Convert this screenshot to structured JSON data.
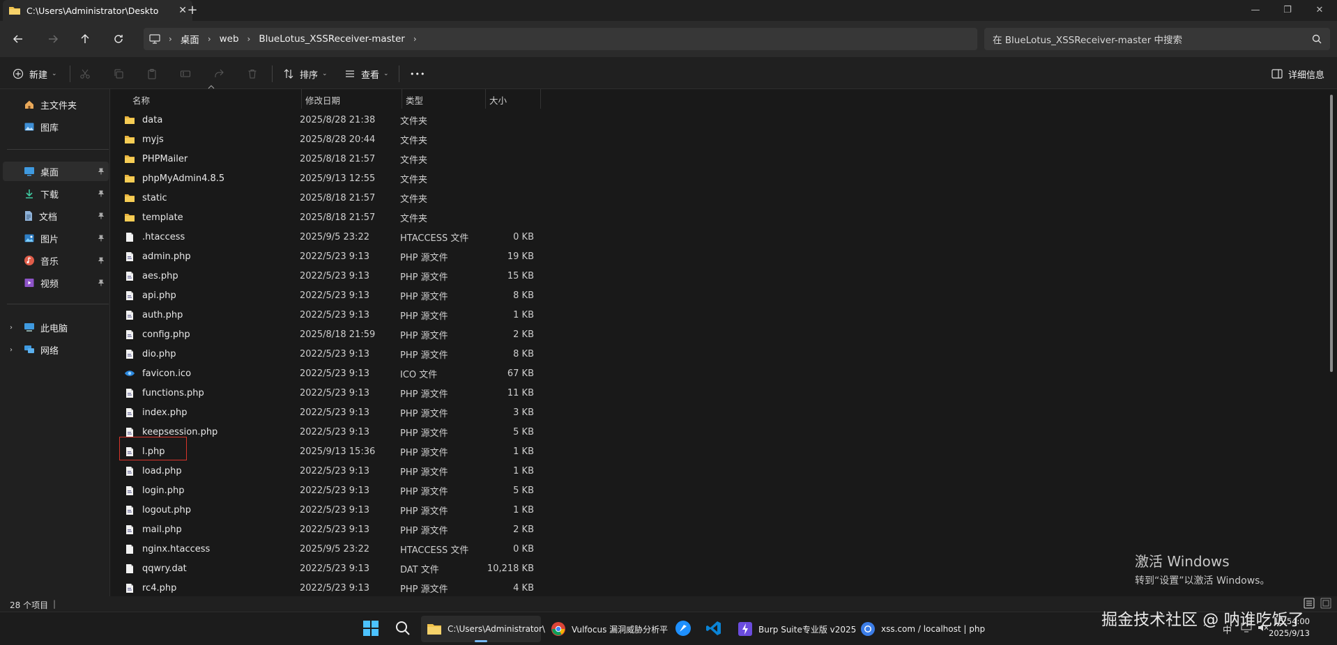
{
  "window": {
    "tab_title": "C:\\Users\\Administrator\\Deskto",
    "tab_close": "✕",
    "new_tab": "+",
    "min": "—",
    "max": "❐",
    "close": "✕"
  },
  "address": {
    "crumbs": [
      "桌面",
      "web",
      "BlueLotus_XSSReceiver-master"
    ],
    "search_placeholder": "在 BlueLotus_XSSReceiver-master 中搜索"
  },
  "toolbar": {
    "new": "新建",
    "sort": "排序",
    "view": "查看",
    "more": "•••",
    "details": "详细信息"
  },
  "sidebar": {
    "quick": [
      {
        "label": "主文件夹",
        "icon": "home-icon"
      },
      {
        "label": "图库",
        "icon": "gallery-icon"
      }
    ],
    "pinned": [
      {
        "label": "桌面",
        "icon": "desktop-icon"
      },
      {
        "label": "下载",
        "icon": "download-icon"
      },
      {
        "label": "文档",
        "icon": "document-icon"
      },
      {
        "label": "图片",
        "icon": "picture-icon"
      },
      {
        "label": "音乐",
        "icon": "music-icon"
      },
      {
        "label": "视频",
        "icon": "video-icon"
      }
    ],
    "devices": [
      {
        "label": "此电脑",
        "icon": "computer-icon"
      },
      {
        "label": "网络",
        "icon": "network-icon"
      }
    ],
    "pin_glyph": "📌",
    "expand_glyph": "›"
  },
  "columns": {
    "name": "名称",
    "date": "修改日期",
    "type": "类型",
    "size": "大小"
  },
  "files": [
    {
      "name": "data",
      "date": "2025/8/28 21:38",
      "type": "文件夹",
      "size": "",
      "kind": "folder"
    },
    {
      "name": "myjs",
      "date": "2025/8/28 20:44",
      "type": "文件夹",
      "size": "",
      "kind": "folder"
    },
    {
      "name": "PHPMailer",
      "date": "2025/8/18 21:57",
      "type": "文件夹",
      "size": "",
      "kind": "folder"
    },
    {
      "name": "phpMyAdmin4.8.5",
      "date": "2025/9/13 12:55",
      "type": "文件夹",
      "size": "",
      "kind": "folder"
    },
    {
      "name": "static",
      "date": "2025/8/18 21:57",
      "type": "文件夹",
      "size": "",
      "kind": "folder"
    },
    {
      "name": "template",
      "date": "2025/8/18 21:57",
      "type": "文件夹",
      "size": "",
      "kind": "folder"
    },
    {
      "name": ".htaccess",
      "date": "2025/9/5 23:22",
      "type": "HTACCESS 文件",
      "size": "0 KB",
      "kind": "file"
    },
    {
      "name": "admin.php",
      "date": "2022/5/23 9:13",
      "type": "PHP 源文件",
      "size": "19 KB",
      "kind": "php"
    },
    {
      "name": "aes.php",
      "date": "2022/5/23 9:13",
      "type": "PHP 源文件",
      "size": "15 KB",
      "kind": "php"
    },
    {
      "name": "api.php",
      "date": "2022/5/23 9:13",
      "type": "PHP 源文件",
      "size": "8 KB",
      "kind": "php"
    },
    {
      "name": "auth.php",
      "date": "2022/5/23 9:13",
      "type": "PHP 源文件",
      "size": "1 KB",
      "kind": "php"
    },
    {
      "name": "config.php",
      "date": "2025/8/18 21:59",
      "type": "PHP 源文件",
      "size": "2 KB",
      "kind": "php"
    },
    {
      "name": "dio.php",
      "date": "2022/5/23 9:13",
      "type": "PHP 源文件",
      "size": "8 KB",
      "kind": "php"
    },
    {
      "name": "favicon.ico",
      "date": "2022/5/23 9:13",
      "type": "ICO 文件",
      "size": "67 KB",
      "kind": "ico"
    },
    {
      "name": "functions.php",
      "date": "2022/5/23 9:13",
      "type": "PHP 源文件",
      "size": "11 KB",
      "kind": "php"
    },
    {
      "name": "index.php",
      "date": "2022/5/23 9:13",
      "type": "PHP 源文件",
      "size": "3 KB",
      "kind": "php"
    },
    {
      "name": "keepsession.php",
      "date": "2022/5/23 9:13",
      "type": "PHP 源文件",
      "size": "5 KB",
      "kind": "php"
    },
    {
      "name": "l.php",
      "date": "2025/9/13 15:36",
      "type": "PHP 源文件",
      "size": "1 KB",
      "kind": "php"
    },
    {
      "name": "load.php",
      "date": "2022/5/23 9:13",
      "type": "PHP 源文件",
      "size": "1 KB",
      "kind": "php"
    },
    {
      "name": "login.php",
      "date": "2022/5/23 9:13",
      "type": "PHP 源文件",
      "size": "5 KB",
      "kind": "php"
    },
    {
      "name": "logout.php",
      "date": "2022/5/23 9:13",
      "type": "PHP 源文件",
      "size": "1 KB",
      "kind": "php"
    },
    {
      "name": "mail.php",
      "date": "2022/5/23 9:13",
      "type": "PHP 源文件",
      "size": "2 KB",
      "kind": "php"
    },
    {
      "name": "nginx.htaccess",
      "date": "2025/9/5 23:22",
      "type": "HTACCESS 文件",
      "size": "0 KB",
      "kind": "file"
    },
    {
      "name": "qqwry.dat",
      "date": "2022/5/23 9:13",
      "type": "DAT 文件",
      "size": "10,218 KB",
      "kind": "file"
    },
    {
      "name": "rc4.php",
      "date": "2022/5/23 9:13",
      "type": "PHP 源文件",
      "size": "4 KB",
      "kind": "php"
    }
  ],
  "status": {
    "count": "28 个项目",
    "sep": "|"
  },
  "watermark": {
    "activate_title": "激活 Windows",
    "activate_sub": "转到“设置”以激活 Windows。",
    "community": "掘金技术社区 @ 呐谁吃饭了"
  },
  "taskbar": {
    "explorer": "C:\\Users\\Administrator\\",
    "chrome": "Vulfocus 漏洞威胁分析平",
    "burp": "Burp Suite专业版  v2025",
    "browser2": "xss.com / localhost | php",
    "time": "15:54:00",
    "date": "2025/9/13",
    "tray_up": "⌃",
    "tray_ime": "中"
  },
  "colors": {
    "accent": "#78b8f5",
    "folder": "#f0c24c",
    "highlight": "#d9342b"
  }
}
